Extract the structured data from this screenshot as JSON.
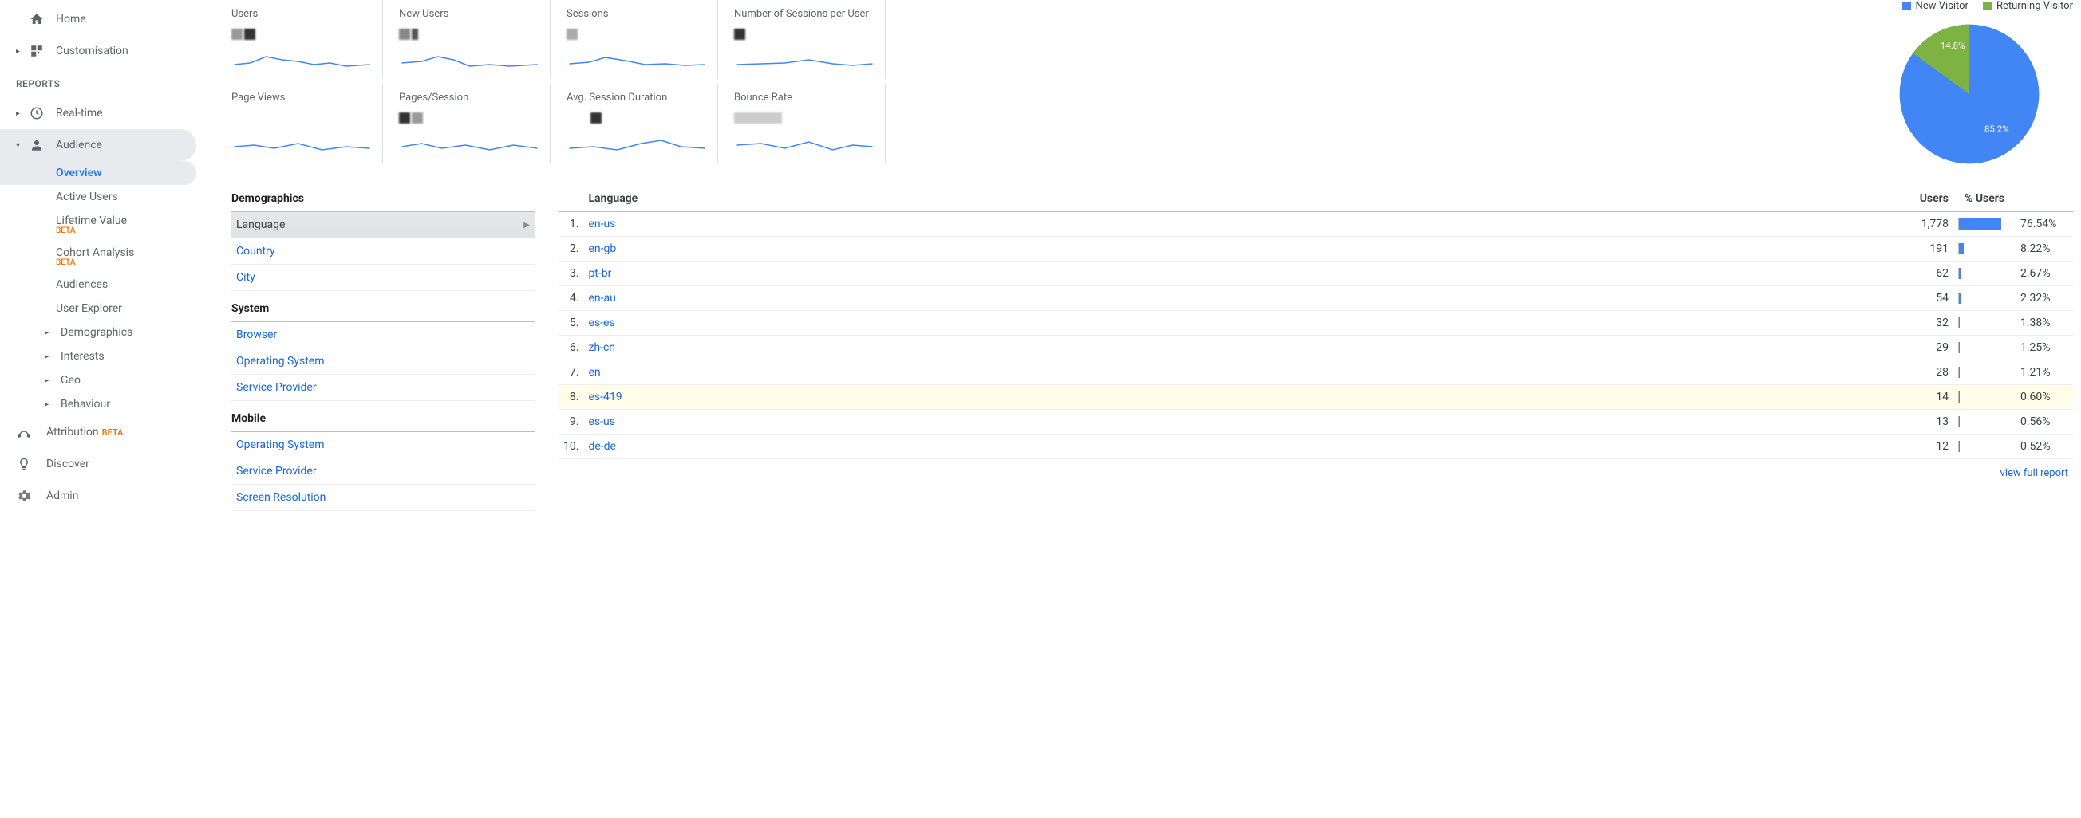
{
  "sidebar": {
    "items": [
      {
        "label": "Home",
        "icon": "home"
      },
      {
        "label": "Customisation",
        "icon": "dashboard"
      }
    ],
    "reports_label": "REPORTS",
    "reports": [
      {
        "label": "Real-time",
        "icon": "clock"
      },
      {
        "label": "Audience",
        "icon": "person",
        "expanded": true
      }
    ],
    "audience_sub": [
      {
        "label": "Overview",
        "selected": true
      },
      {
        "label": "Active Users"
      },
      {
        "label": "Lifetime Value",
        "beta": "BETA"
      },
      {
        "label": "Cohort Analysis",
        "beta": "BETA"
      },
      {
        "label": "Audiences"
      },
      {
        "label": "User Explorer"
      },
      {
        "label": "Demographics",
        "caret": true
      },
      {
        "label": "Interests",
        "caret": true
      },
      {
        "label": "Geo",
        "caret": true
      },
      {
        "label": "Behaviour",
        "caret": true
      }
    ],
    "bottom": [
      {
        "label": "Attribution",
        "beta_inline": "BETA",
        "icon": "attribution"
      },
      {
        "label": "Discover",
        "icon": "bulb"
      },
      {
        "label": "Admin",
        "icon": "gear"
      }
    ]
  },
  "metrics": {
    "row1": [
      {
        "label": "Users"
      },
      {
        "label": "New Users"
      },
      {
        "label": "Sessions"
      },
      {
        "label": "Number of Sessions per User"
      }
    ],
    "row2": [
      {
        "label": "Page Views"
      },
      {
        "label": "Pages/Session"
      },
      {
        "label": "Avg. Session Duration"
      },
      {
        "label": "Bounce Rate"
      }
    ]
  },
  "chart_data": {
    "type": "pie",
    "title": "",
    "series": [
      {
        "name": "New Visitor",
        "value": 85.2,
        "color": "#4285f4"
      },
      {
        "name": "Returning Visitor",
        "value": 14.8,
        "color": "#7cb342"
      }
    ],
    "labels": {
      "new": "85.2%",
      "returning": "14.8%"
    }
  },
  "legend": {
    "new": "New Visitor",
    "returning": "Returning Visitor",
    "new_color": "#4285f4",
    "returning_color": "#7cb342"
  },
  "dimensions": {
    "demographics_header": "Demographics",
    "demo_items": [
      {
        "label": "Language",
        "active": true
      },
      {
        "label": "Country"
      },
      {
        "label": "City"
      }
    ],
    "system_header": "System",
    "system_items": [
      {
        "label": "Browser"
      },
      {
        "label": "Operating System"
      },
      {
        "label": "Service Provider"
      }
    ],
    "mobile_header": "Mobile",
    "mobile_items": [
      {
        "label": "Operating System"
      },
      {
        "label": "Service Provider"
      },
      {
        "label": "Screen Resolution"
      }
    ]
  },
  "table": {
    "headers": {
      "dim": "Language",
      "users": "Users",
      "pct": "% Users"
    },
    "rows": [
      {
        "rank": "1.",
        "lang": "en-us",
        "users": "1,778",
        "pct": "76.54%",
        "bar": 76.54
      },
      {
        "rank": "2.",
        "lang": "en-gb",
        "users": "191",
        "pct": "8.22%",
        "bar": 8.22
      },
      {
        "rank": "3.",
        "lang": "pt-br",
        "users": "62",
        "pct": "2.67%",
        "bar": 2.67
      },
      {
        "rank": "4.",
        "lang": "en-au",
        "users": "54",
        "pct": "2.32%",
        "bar": 2.32
      },
      {
        "rank": "5.",
        "lang": "es-es",
        "users": "32",
        "pct": "1.38%",
        "bar": 1.38
      },
      {
        "rank": "6.",
        "lang": "zh-cn",
        "users": "29",
        "pct": "1.25%",
        "bar": 1.25
      },
      {
        "rank": "7.",
        "lang": "en",
        "users": "28",
        "pct": "1.21%",
        "bar": 1.21
      },
      {
        "rank": "8.",
        "lang": "es-419",
        "users": "14",
        "pct": "0.60%",
        "bar": 0.6,
        "highlight": true
      },
      {
        "rank": "9.",
        "lang": "es-us",
        "users": "13",
        "pct": "0.56%",
        "bar": 0.56
      },
      {
        "rank": "10.",
        "lang": "de-de",
        "users": "12",
        "pct": "0.52%",
        "bar": 0.52
      }
    ],
    "footer_link": "view full report"
  }
}
